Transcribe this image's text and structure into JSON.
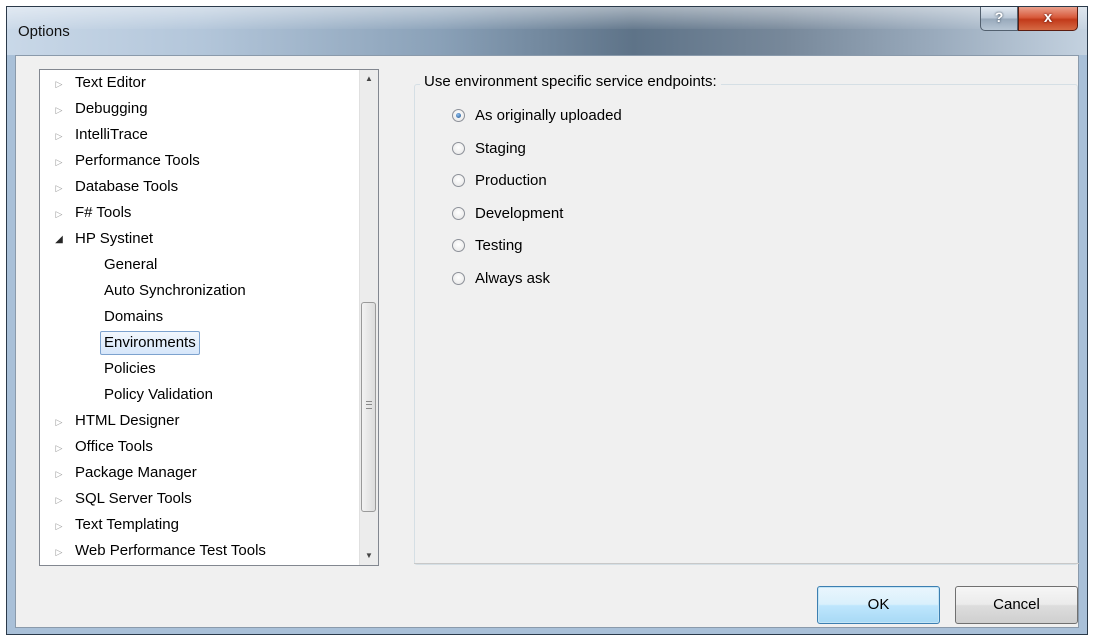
{
  "window": {
    "title": "Options",
    "help_glyph": "?",
    "close_glyph": "x"
  },
  "tree": {
    "items": [
      {
        "label": "Text Editor",
        "level": 0,
        "expander": "collapsed"
      },
      {
        "label": "Debugging",
        "level": 0,
        "expander": "collapsed"
      },
      {
        "label": "IntelliTrace",
        "level": 0,
        "expander": "collapsed"
      },
      {
        "label": "Performance Tools",
        "level": 0,
        "expander": "collapsed"
      },
      {
        "label": "Database Tools",
        "level": 0,
        "expander": "collapsed"
      },
      {
        "label": "F# Tools",
        "level": 0,
        "expander": "collapsed"
      },
      {
        "label": "HP Systinet",
        "level": 0,
        "expander": "expanded"
      },
      {
        "label": "General",
        "level": 1,
        "expander": "none"
      },
      {
        "label": "Auto Synchronization",
        "level": 1,
        "expander": "none"
      },
      {
        "label": "Domains",
        "level": 1,
        "expander": "none"
      },
      {
        "label": "Environments",
        "level": 1,
        "expander": "none",
        "selected": true
      },
      {
        "label": "Policies",
        "level": 1,
        "expander": "none"
      },
      {
        "label": "Policy Validation",
        "level": 1,
        "expander": "none"
      },
      {
        "label": "HTML Designer",
        "level": 0,
        "expander": "collapsed"
      },
      {
        "label": "Office Tools",
        "level": 0,
        "expander": "collapsed"
      },
      {
        "label": "Package Manager",
        "level": 0,
        "expander": "collapsed"
      },
      {
        "label": "SQL Server Tools",
        "level": 0,
        "expander": "collapsed"
      },
      {
        "label": "Text Templating",
        "level": 0,
        "expander": "collapsed"
      },
      {
        "label": "Web Performance Test Tools",
        "level": 0,
        "expander": "collapsed"
      }
    ]
  },
  "endpoints": {
    "group_title": "Use environment specific service endpoints:",
    "options": [
      {
        "label": "As originally uploaded",
        "checked": true
      },
      {
        "label": "Staging",
        "checked": false
      },
      {
        "label": "Production",
        "checked": false
      },
      {
        "label": "Development",
        "checked": false
      },
      {
        "label": "Testing",
        "checked": false
      },
      {
        "label": "Always ask",
        "checked": false
      }
    ]
  },
  "buttons": {
    "ok_label": "OK",
    "cancel_label": "Cancel"
  },
  "colors": {
    "selection_border": "#7da2ce",
    "close_button": "#c23a1a",
    "default_button_border": "#3c7fb1"
  }
}
